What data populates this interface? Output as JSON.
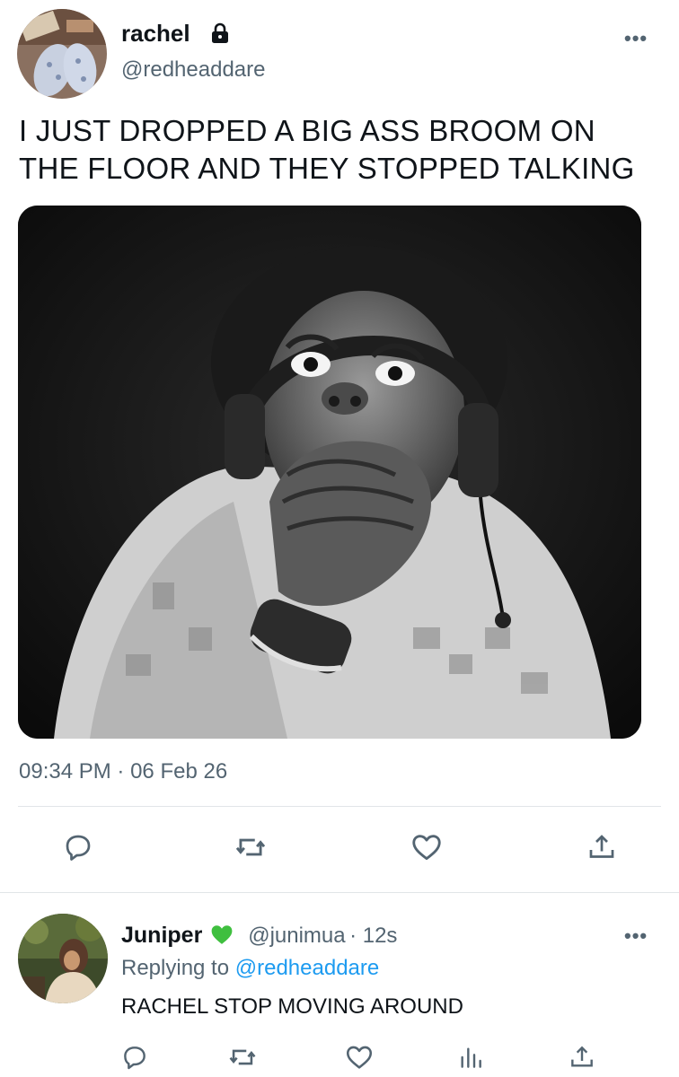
{
  "tweet": {
    "author_name": "rachel",
    "author_handle": "@redheaddare",
    "text_line1": "I JUST DROPPED A BIG ASS BROOM ON",
    "text_line2": "THE FLOOR AND THEY STOPPED TALKING",
    "time": "09:34 PM",
    "separator": "·",
    "date": "06 Feb 26",
    "more": "•••",
    "icons": [
      "lock-icon",
      "reply-icon",
      "retweet-icon",
      "like-icon",
      "share-icon"
    ]
  },
  "reply": {
    "author_name": "Juniper",
    "badge": "green-heart",
    "author_handle": "@junimua",
    "age": "· 12s",
    "replying_prefix": "Replying to",
    "replying_handle": "@redheaddare",
    "text": "RACHEL STOP MOVING AROUND",
    "more": "•••",
    "icons": [
      "reply-icon",
      "retweet-icon",
      "like-icon",
      "analytics-icon",
      "share-icon"
    ]
  },
  "colors": {
    "link": "#1d9bf0",
    "secondary_text": "#536471",
    "heart_badge": "#3fbf3f"
  }
}
